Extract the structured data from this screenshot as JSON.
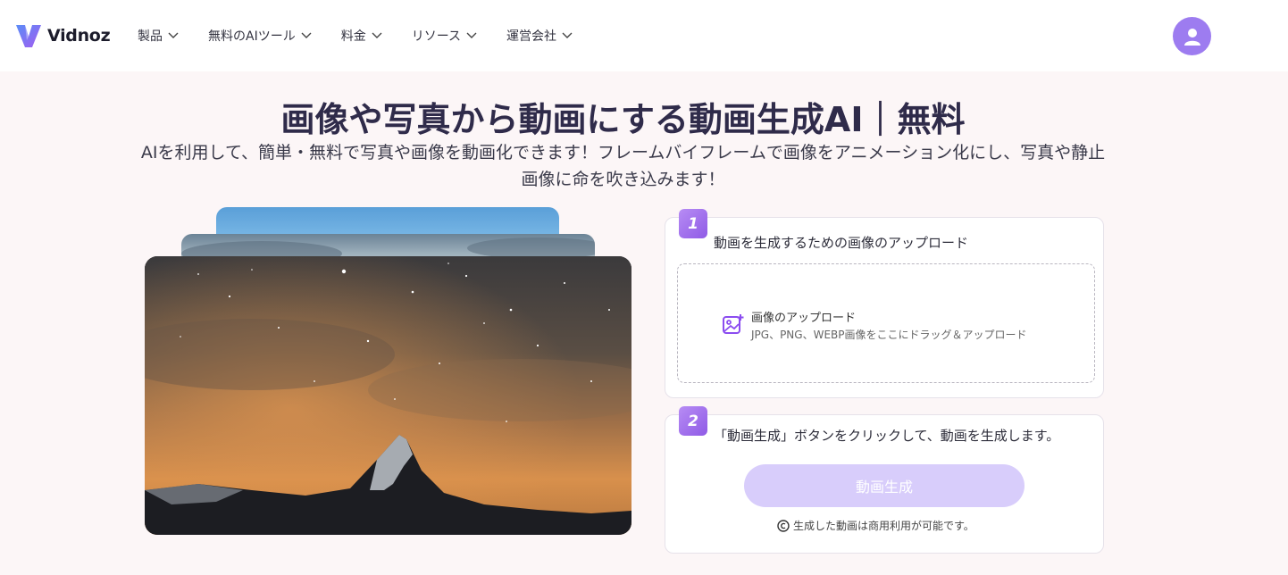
{
  "header": {
    "logo_text": "Vidnoz",
    "nav": [
      {
        "label": "製品"
      },
      {
        "label": "無料のAIツール"
      },
      {
        "label": "料金"
      },
      {
        "label": "リソース"
      },
      {
        "label": "運営会社"
      }
    ],
    "avatar_icon": "user-icon"
  },
  "hero": {
    "title": "画像や写真から動画にする動画生成AI｜無料",
    "subtitle": "AIを利用して、簡単・無料で写真や画像を動画化できます！フレームバイフレームで画像をアニメーション化にし、写真や静止画像に命を吹き込みます！"
  },
  "steps": [
    {
      "number": "1",
      "text": "動画を生成するための画像のアップロード"
    },
    {
      "number": "2",
      "text": "「動画生成」ボタンをクリックして、動画を生成します。"
    }
  ],
  "upload": {
    "title": "画像のアップロード",
    "hint": "JPG、PNG、WEBP画像をここにドラッグ＆アップロード",
    "icon": "image-add-icon"
  },
  "generate": {
    "button_label": "動画生成",
    "note": "生成した動画は商用利用が可能です。",
    "note_icon": "copyright-icon"
  },
  "colors": {
    "brand": "#8b5cf6",
    "button_disabled": "#d8cdfb",
    "page_bg": "#fcf6f7"
  }
}
